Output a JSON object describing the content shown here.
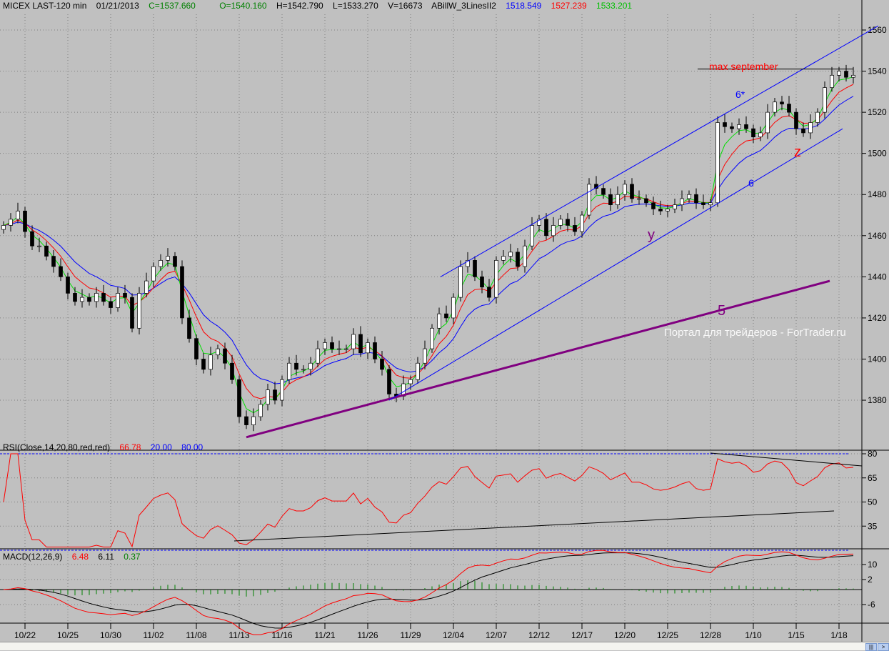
{
  "header": {
    "symbol": "MICEX LAST-120 min",
    "date": "01/21/2013",
    "close": "C=1537.660",
    "open": "O=1540.160",
    "high": "H=1542.790",
    "low": "L=1533.270",
    "volume": "V=16673",
    "indicator": "ABillW_3LinesII2",
    "ind_blue": "1518.549",
    "ind_red": "1527.239",
    "ind_green": "1533.201"
  },
  "rsi_header": {
    "name": "RSI(Close,14,20,80,red,red)",
    "value": "66.78",
    "low": "20.00",
    "high": "80.00"
  },
  "macd_header": {
    "name": "MACD(12,26,9)",
    "macd": "6.48",
    "signal": "6.11",
    "hist": "0.37"
  },
  "watermark": "Портал для трейдеров - ForTrader.ru",
  "colors": {
    "bg": "#c0c0c0",
    "up": "#ffffff",
    "down": "#000000",
    "ma_green": "#00e000",
    "ma_red": "#ff0000",
    "ma_blue": "#0000ff",
    "trend": "#800080"
  },
  "chart_data": {
    "type": "candlestick",
    "title": "MICEX LAST-120 min",
    "ylim": [
      1360,
      1565
    ],
    "price_ticks": [
      1380,
      1400,
      1420,
      1440,
      1460,
      1480,
      1500,
      1520,
      1540,
      1560
    ],
    "rsi_ticks": [
      "80",
      "65",
      "50",
      "35"
    ],
    "macd_ticks": [
      "10",
      "2",
      "-6"
    ],
    "x_ticks": [
      {
        "bar": 3,
        "label": "10/22"
      },
      {
        "bar": 9,
        "label": "10/25"
      },
      {
        "bar": 15,
        "label": "10/30"
      },
      {
        "bar": 21,
        "label": "11/02"
      },
      {
        "bar": 27,
        "label": "11/08"
      },
      {
        "bar": 33,
        "label": "11/13"
      },
      {
        "bar": 39,
        "label": "11/16"
      },
      {
        "bar": 45,
        "label": "11/21"
      },
      {
        "bar": 51,
        "label": "11/26"
      },
      {
        "bar": 57,
        "label": "11/29"
      },
      {
        "bar": 63,
        "label": "12/04"
      },
      {
        "bar": 69,
        "label": "12/07"
      },
      {
        "bar": 75,
        "label": "12/12"
      },
      {
        "bar": 81,
        "label": "12/17"
      },
      {
        "bar": 87,
        "label": "12/20"
      },
      {
        "bar": 93,
        "label": "12/25"
      },
      {
        "bar": 99,
        "label": "12/28"
      },
      {
        "bar": 105,
        "label": "1/10"
      },
      {
        "bar": 111,
        "label": "1/15"
      },
      {
        "bar": 117,
        "label": "1/18"
      }
    ],
    "closes": [
      1465,
      1468,
      1472,
      1462,
      1455,
      1455,
      1450,
      1445,
      1440,
      1432,
      1428,
      1430,
      1428,
      1432,
      1428,
      1425,
      1432,
      1430,
      1415,
      1432,
      1438,
      1445,
      1448,
      1450,
      1445,
      1420,
      1410,
      1400,
      1395,
      1402,
      1405,
      1398,
      1390,
      1372,
      1368,
      1372,
      1378,
      1385,
      1380,
      1390,
      1398,
      1395,
      1395,
      1398,
      1405,
      1408,
      1405,
      1405,
      1405,
      1412,
      1403,
      1408,
      1400,
      1395,
      1383,
      1382,
      1388,
      1390,
      1398,
      1405,
      1415,
      1422,
      1420,
      1430,
      1445,
      1448,
      1440,
      1435,
      1430,
      1448,
      1450,
      1452,
      1445,
      1455,
      1465,
      1468,
      1460,
      1465,
      1468,
      1465,
      1462,
      1470,
      1485,
      1483,
      1480,
      1475,
      1480,
      1485,
      1478,
      1478,
      1476,
      1473,
      1472,
      1473,
      1475,
      1478,
      1480,
      1476,
      1475,
      1476,
      1515,
      1513,
      1512,
      1514,
      1512,
      1508,
      1510,
      1520,
      1525,
      1524,
      1520,
      1512,
      1510,
      1515,
      1520,
      1532,
      1538,
      1540,
      1537,
      1538
    ],
    "trendlines": [
      {
        "name": "5",
        "color": "#800080",
        "from": [
          34,
          1362
        ],
        "to": [
          115.7,
          1438
        ]
      },
      {
        "name": "6",
        "color": "#0000ff",
        "from": [
          54,
          1380
        ],
        "to": [
          117.5,
          1512
        ]
      },
      {
        "name": "6*",
        "color": "#0000ff",
        "from": [
          61.2,
          1440
        ],
        "to": [
          122.5,
          1562
        ]
      },
      {
        "name": "max september",
        "color": "#000000",
        "from": [
          97.2,
          1541
        ],
        "to": [
          119,
          1541
        ]
      }
    ],
    "annotations": [
      {
        "text": "max september",
        "color": "#ff0000"
      },
      {
        "text": "6*",
        "color": "#0000ff"
      },
      {
        "text": "6",
        "color": "#0000ff"
      },
      {
        "text": "y",
        "color": "#800080"
      },
      {
        "text": "z",
        "color": "#ff0000"
      },
      {
        "text": "5",
        "color": "#800080"
      }
    ]
  }
}
